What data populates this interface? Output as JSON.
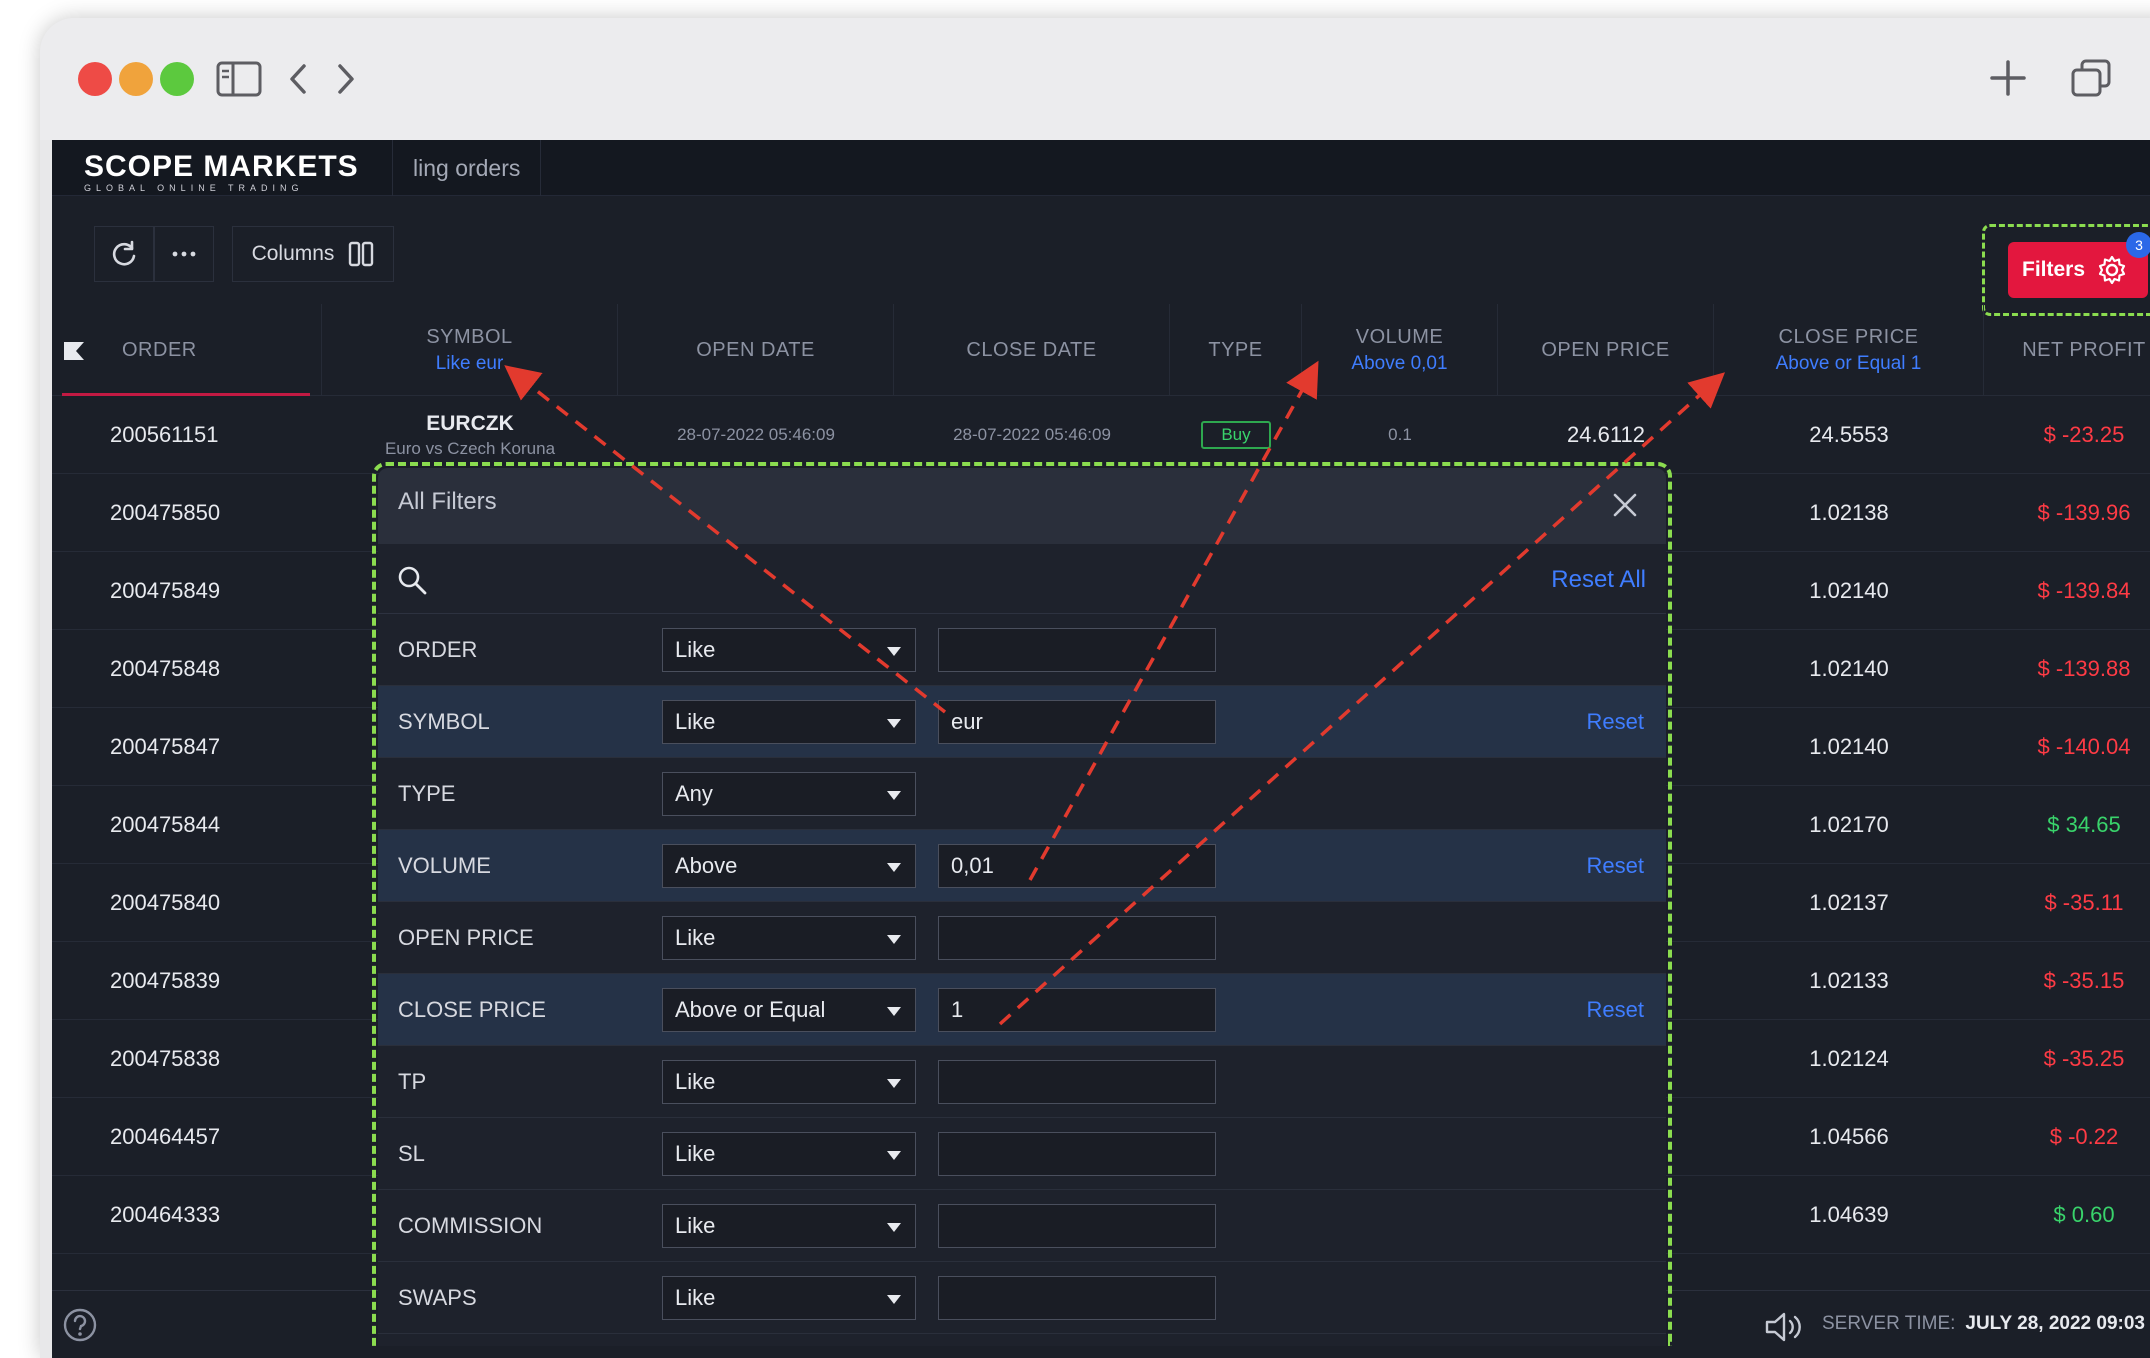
{
  "app": {
    "logo_title": "SCOPE MARKETS",
    "logo_subtitle": "GLOBAL ONLINE TRADING",
    "tab_label": "ling orders"
  },
  "toolbar": {
    "columns_label": "Columns",
    "filters_label": "Filters",
    "filters_badge": "3"
  },
  "table": {
    "headers": [
      {
        "label": "ORDER",
        "sub": ""
      },
      {
        "label": "SYMBOL",
        "sub": "Like eur"
      },
      {
        "label": "OPEN DATE",
        "sub": ""
      },
      {
        "label": "CLOSE DATE",
        "sub": ""
      },
      {
        "label": "TYPE",
        "sub": ""
      },
      {
        "label": "VOLUME",
        "sub": "Above 0,01"
      },
      {
        "label": "OPEN PRICE",
        "sub": ""
      },
      {
        "label": "CLOSE PRICE",
        "sub": "Above or Equal 1"
      },
      {
        "label": "NET PROFIT",
        "sub": ""
      }
    ],
    "first_row": {
      "order": "200561151",
      "symbol": "EURCZK",
      "symbol_desc": "Euro vs Czech Koruna",
      "open_date": "28-07-2022 05:46:09",
      "close_date": "28-07-2022 05:46:09",
      "type": "Buy",
      "volume": "0.1",
      "open_price": "24.6112",
      "close_price": "24.5553",
      "net_profit": "$ -23.25"
    },
    "rows": [
      {
        "order": "200475850",
        "close_price": "1.02138",
        "net_profit": "$ -139.96",
        "positive": false
      },
      {
        "order": "200475849",
        "close_price": "1.02140",
        "net_profit": "$ -139.84",
        "positive": false
      },
      {
        "order": "200475848",
        "close_price": "1.02140",
        "net_profit": "$ -139.88",
        "positive": false
      },
      {
        "order": "200475847",
        "close_price": "1.02140",
        "net_profit": "$ -140.04",
        "positive": false
      },
      {
        "order": "200475844",
        "close_price": "1.02170",
        "net_profit": "$ 34.65",
        "positive": true
      },
      {
        "order": "200475840",
        "close_price": "1.02137",
        "net_profit": "$ -35.11",
        "positive": false
      },
      {
        "order": "200475839",
        "close_price": "1.02133",
        "net_profit": "$ -35.15",
        "positive": false
      },
      {
        "order": "200475838",
        "close_price": "1.02124",
        "net_profit": "$ -35.25",
        "positive": false
      },
      {
        "order": "200464457",
        "close_price": "1.04566",
        "net_profit": "$ -0.22",
        "positive": false
      },
      {
        "order": "200464333",
        "close_price": "1.04639",
        "net_profit": "$ 0.60",
        "positive": true
      }
    ]
  },
  "filters_panel": {
    "title": "All Filters",
    "reset_all": "Reset All",
    "reset_label": "Reset",
    "rows": [
      {
        "label": "ORDER",
        "operator": "Like",
        "value": "",
        "has_input": true,
        "active": false
      },
      {
        "label": "SYMBOL",
        "operator": "Like",
        "value": "eur",
        "has_input": true,
        "active": true
      },
      {
        "label": "TYPE",
        "operator": "Any",
        "value": "",
        "has_input": false,
        "active": false
      },
      {
        "label": "VOLUME",
        "operator": "Above",
        "value": "0,01",
        "has_input": true,
        "active": true
      },
      {
        "label": "OPEN PRICE",
        "operator": "Like",
        "value": "",
        "has_input": true,
        "active": false
      },
      {
        "label": "CLOSE PRICE",
        "operator": "Above or Equal",
        "value": "1",
        "has_input": true,
        "active": true
      },
      {
        "label": "TP",
        "operator": "Like",
        "value": "",
        "has_input": true,
        "active": false
      },
      {
        "label": "SL",
        "operator": "Like",
        "value": "",
        "has_input": true,
        "active": false
      },
      {
        "label": "COMMISSION",
        "operator": "Like",
        "value": "",
        "has_input": true,
        "active": false
      },
      {
        "label": "SWAPS",
        "operator": "Like",
        "value": "",
        "has_input": true,
        "active": false
      }
    ]
  },
  "status": {
    "server_time_label": "SERVER TIME:",
    "server_time_value": "JULY 28, 2022 09:03"
  },
  "icons": [
    "sidebar-toggle-icon",
    "back-icon",
    "forward-icon",
    "new-tab-icon",
    "tabs-overview-icon",
    "refresh-icon",
    "more-icon",
    "columns-icon",
    "gear-icon",
    "close-icon",
    "search-icon",
    "chevron-down-icon",
    "help-icon",
    "speaker-icon",
    "sort-flag-icon"
  ],
  "colors": {
    "accent_red": "#e3173e",
    "link_blue": "#3f7dff",
    "highlight_green": "#8bdc4f",
    "profit_negative": "#ff3b45",
    "profit_positive": "#39d36b",
    "annotation_arrow": "#e23a2e"
  }
}
